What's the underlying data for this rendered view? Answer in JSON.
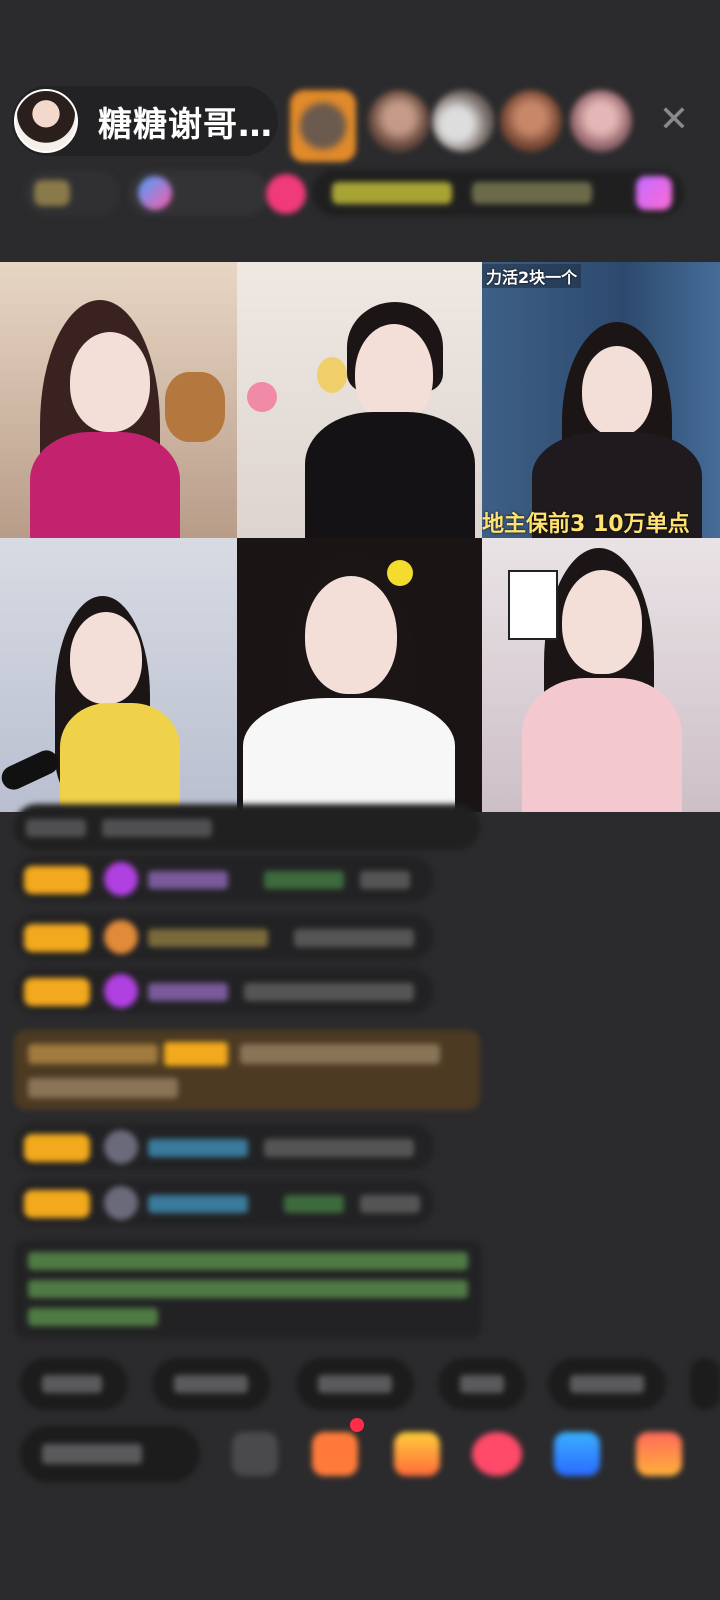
{
  "host": {
    "name": "糖糖谢哥…"
  },
  "icons": {
    "close": "close-icon",
    "close_glyph": "✕"
  },
  "grid": {
    "cells": [
      {
        "id": "guest-1"
      },
      {
        "id": "guest-2"
      },
      {
        "id": "guest-3",
        "overlay_top": "力活2块一个",
        "overlay_bottom": "地主保前3  10万单点"
      },
      {
        "id": "guest-4"
      },
      {
        "id": "guest-5"
      },
      {
        "id": "guest-6"
      }
    ]
  },
  "colors": {
    "background": "#2b2b2d",
    "badge": "#f2a91d",
    "notice_text": "#7fbf6a",
    "special_bg": "#4c3a22"
  }
}
